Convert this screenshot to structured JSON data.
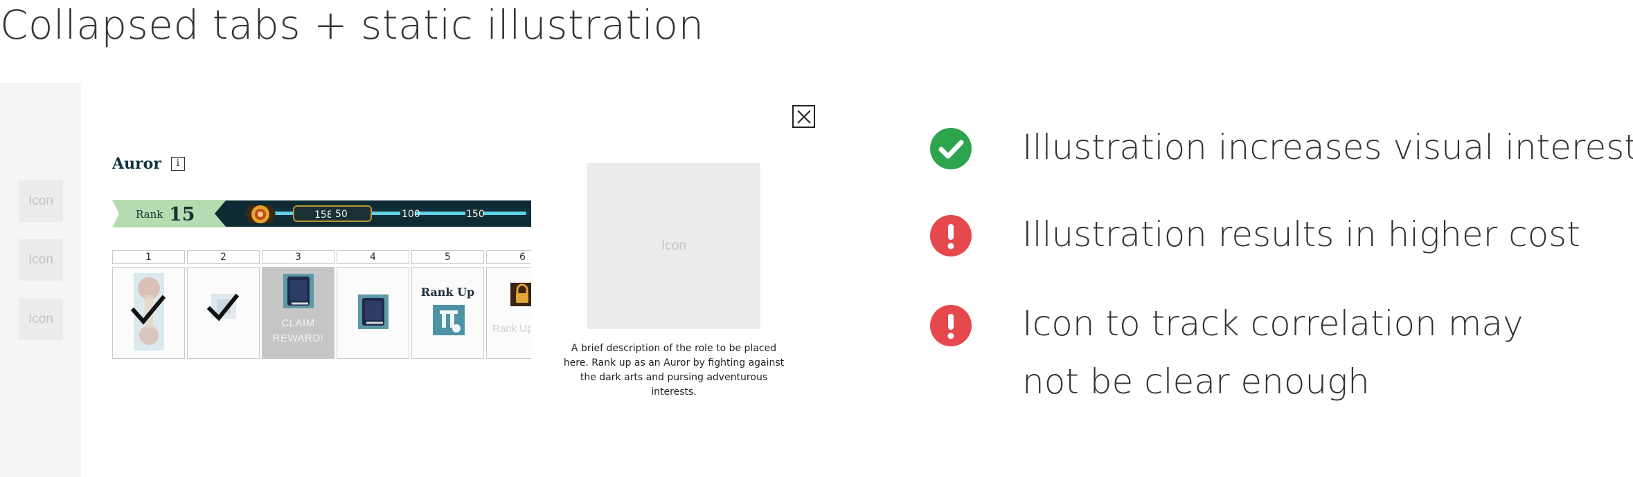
{
  "page": {
    "title": "Collapsed tabs + static illustration"
  },
  "left_rail": {
    "items": [
      "Icon",
      "Icon",
      "Icon"
    ]
  },
  "dialog": {
    "close_icon": "close-icon",
    "role_title": "Auror",
    "info_icon": "i",
    "rank": {
      "label": "Rank",
      "number": "15",
      "xp_current": "158",
      "progress_marks": [
        "50",
        "100",
        "150"
      ]
    },
    "reward_track": {
      "cells": [
        {
          "number": "1",
          "state": "claimed",
          "icon": "hourglass-reward-icon"
        },
        {
          "number": "2",
          "state": "claimed",
          "icon": "reward-icon"
        },
        {
          "number": "3",
          "state": "claimable",
          "icon": "book-icon",
          "label": "CLAIM REWARD!"
        },
        {
          "number": "4",
          "state": "locked",
          "icon": "book-icon"
        },
        {
          "number": "5",
          "state": "rank-up",
          "icon": "pedestal-icon",
          "label": "Rank Up"
        },
        {
          "number": "6",
          "state": "locked",
          "icon": "padlock-icon",
          "label": "Rank Up to see rewards"
        }
      ]
    },
    "illustration": {
      "placeholder": "Icon"
    },
    "description": "A brief description of the role to be placed here. Rank up as an Auror by fighting against the dark arts and pursing adventurous interests."
  },
  "evaluation": {
    "points": [
      {
        "type": "positive",
        "icon": "check-circle-icon",
        "lines": [
          "Illustration increases visual interest"
        ]
      },
      {
        "type": "negative",
        "icon": "exclamation-circle-icon",
        "lines": [
          "Illustration results in higher cost"
        ]
      },
      {
        "type": "negative",
        "icon": "exclamation-circle-icon",
        "lines": [
          "Icon to track correlation may",
          "not be clear enough"
        ]
      }
    ],
    "colors": {
      "positive": "#2ea44f",
      "negative": "#e5484d"
    }
  }
}
